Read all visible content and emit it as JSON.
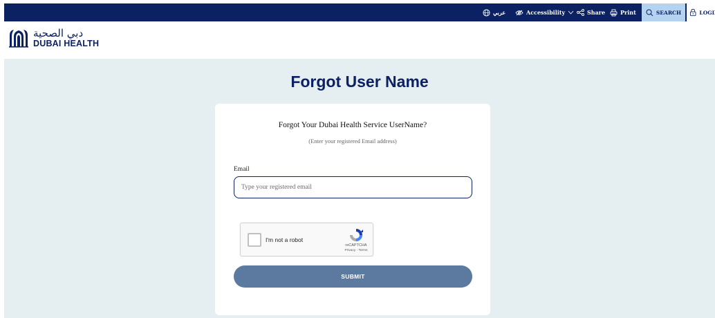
{
  "topbar": {
    "language": "عربي",
    "accessibility": "Accessibility",
    "share": "Share",
    "print": "Print",
    "search": "SEARCH",
    "login": "LOGIN"
  },
  "logo": {
    "arabic": "دبي الصحية",
    "english": "DUBAI HEALTH"
  },
  "main": {
    "title": "Forgot User Name",
    "form": {
      "heading": "Forgot Your Dubai Health Service UserName?",
      "subheading": "(Enter your registered Email address)",
      "email_label": "Email",
      "email_value": "",
      "email_placeholder": "Type your registered email",
      "submit_label": "SUBMIT"
    }
  },
  "recaptcha": {
    "label": "I'm not a robot",
    "brand": "reCAPTCHA",
    "links": "Privacy - Terms"
  },
  "colors": {
    "navy": "#0b2161",
    "background": "#e5eef1",
    "search_bg": "#b3d3f1",
    "submit_bg": "#5c799f"
  }
}
